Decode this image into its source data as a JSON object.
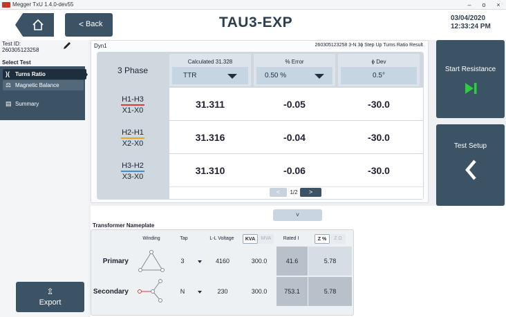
{
  "window": {
    "title": "Megger TxU 1.4.0-dev55",
    "controls": [
      "–",
      "o",
      "×"
    ]
  },
  "header": {
    "back_label": "Back",
    "back_icon": "<",
    "title": "TAU3-EXP",
    "date": "03/04/2020",
    "time": "12:33:24 PM"
  },
  "sidebar": {
    "test_id_label": "Test ID:",
    "test_id_value": "260305123258",
    "select_test_label": "Select Test",
    "items": [
      {
        "label": "Turns Ratio",
        "icon": "coil-icon",
        "glyph": ")(",
        "active": true
      },
      {
        "label": "Magnetic Balance",
        "icon": "balance-icon",
        "glyph": "⚖",
        "active": false
      },
      {
        "label": "Summary",
        "icon": "summary-icon",
        "glyph": "▤",
        "active": false
      }
    ],
    "export_label": "Export",
    "export_glyph": "⇫"
  },
  "ratio": {
    "winding_config": "Dyn1",
    "result_label": "260305123258 3-N 3ϕ Step Up Turns Ratio Result",
    "phase_label": "3 Phase",
    "columns": [
      {
        "label": "Calculated 31.328",
        "value": "TTR",
        "has_dropdown": true
      },
      {
        "label": "% Error",
        "value": "0.50 %",
        "has_dropdown": true
      },
      {
        "label": "ϕ Dev",
        "value": "0.5°",
        "has_dropdown": false
      }
    ],
    "rows": [
      {
        "top": "H1-H3",
        "bottom": "X1-X0",
        "color": "#d93a3a",
        "ttr": "31.311",
        "error": "-0.05",
        "dev": "-30.0"
      },
      {
        "top": "H2-H1",
        "bottom": "X2-X0",
        "color": "#e6a521",
        "ttr": "31.316",
        "error": "-0.04",
        "dev": "-30.0"
      },
      {
        "top": "H3-H2",
        "bottom": "X3-X0",
        "color": "#3b8ed8",
        "ttr": "31.310",
        "error": "-0.06",
        "dev": "-30.0"
      }
    ],
    "pager": {
      "prev": "<",
      "text": "1/2",
      "next": ">"
    }
  },
  "actions": {
    "start_resistance": "Start Resistance",
    "test_setup": "Test Setup"
  },
  "collapse_glyph": "˅",
  "nameplate": {
    "title": "Transformer Nameplate",
    "headers": {
      "winding": "Winding",
      "tap": "Tap",
      "ll_voltage": "L-L Voltage",
      "kva": "KVA",
      "mva": "MVA",
      "rated_i": "Rated I",
      "z_pct": "Z %",
      "z_ohm": "Z Ω"
    },
    "rows": [
      {
        "label": "Primary",
        "tap": "3",
        "voltage": "4160",
        "kva": "300.0",
        "rated_i": "41.6",
        "z": "5.78"
      },
      {
        "label": "Secondary",
        "tap": "N",
        "voltage": "230",
        "kva": "300.0",
        "rated_i": "753.1",
        "z": "5.78"
      }
    ]
  },
  "colors": {
    "primary_button": "#3c5366",
    "active_nav": "#1e2e3d",
    "play_icon": "#2ecc40"
  }
}
